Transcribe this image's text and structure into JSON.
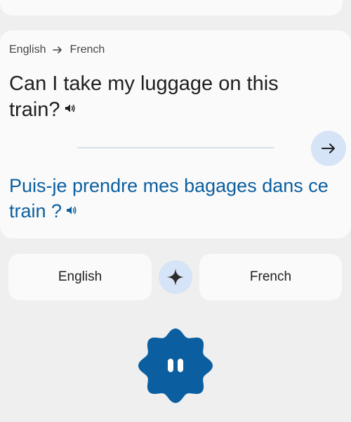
{
  "header": {
    "source_lang": "English",
    "target_lang": "French"
  },
  "translation": {
    "source_text": "Can I take my luggage on this train?",
    "target_text": "Puis-je prendre mes bagages dans ce train ?"
  },
  "language_bar": {
    "left_label": "English",
    "right_label": "French"
  },
  "icons": {
    "route_arrow": "arrow-right-icon",
    "speaker": "volume-icon",
    "go": "arrow-right-icon",
    "sparkle": "sparkle-icon",
    "pause": "pause-icon"
  },
  "colors": {
    "background": "#efefef",
    "card": "#fafafa",
    "accent_blue": "#0b5fa0",
    "accent_light": "#d6e4f7"
  }
}
